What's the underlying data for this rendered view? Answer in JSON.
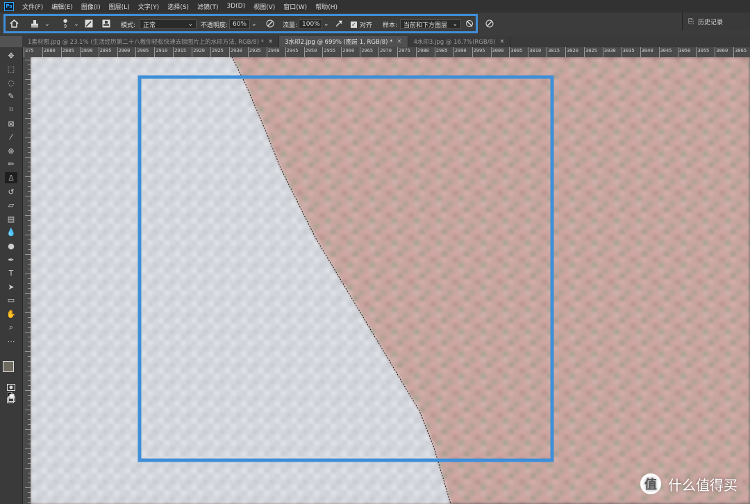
{
  "app": {
    "logo": "Ps"
  },
  "menu": [
    "文件(F)",
    "编辑(E)",
    "图像(I)",
    "图层(L)",
    "文字(Y)",
    "选择(S)",
    "滤镜(T)",
    "3D(D)",
    "视图(V)",
    "窗口(W)",
    "帮助(H)"
  ],
  "options_bar": {
    "brush_size": "9",
    "mode_label": "模式:",
    "mode_value": "正常",
    "opacity_label": "不透明度:",
    "opacity_value": "60%",
    "flow_label": "流量:",
    "flow_value": "100%",
    "align_label": "对齐",
    "align_checked": true,
    "sample_label": "样本:",
    "sample_value": "当前和下方图层"
  },
  "history_panel": {
    "label": "历史记录"
  },
  "tabs": [
    {
      "label": "1素材图.jpg @ 23.1% (生活经历第二十八教你轻松快速去除图片上的水印方法, RGB/8) *",
      "active": false
    },
    {
      "label": "3水印2.jpg @ 699% (图层 1, RGB/8) *",
      "active": true
    },
    {
      "label": "4水印3.jpg @ 16.7%(RGB/8)",
      "active": false
    }
  ],
  "ruler_labels": [
    "375",
    "2880",
    "2885",
    "2890",
    "2895",
    "2900",
    "2905",
    "2910",
    "2915",
    "2920",
    "2925",
    "2930",
    "2935",
    "2940",
    "2945",
    "2950",
    "2955",
    "2960",
    "2965",
    "2970",
    "2975",
    "2980",
    "2985",
    "2990",
    "2995",
    "3000",
    "3005",
    "3010",
    "3015",
    "3020",
    "3025",
    "3030",
    "3035",
    "3040",
    "3045",
    "3050",
    "3055",
    "3060",
    "3065",
    "30"
  ],
  "tools": [
    "move-icon",
    "marquee-icon",
    "lasso-icon",
    "quick-select-icon",
    "crop-icon",
    "frame-icon",
    "eyedropper-icon",
    "healing-icon",
    "brush-icon",
    "clone-stamp-icon",
    "history-brush-icon",
    "eraser-icon",
    "gradient-icon",
    "blur-icon",
    "dodge-icon",
    "pen-icon",
    "type-icon",
    "path-select-icon",
    "rectangle-icon",
    "hand-icon",
    "zoom-icon",
    "more-icon"
  ],
  "colors": {
    "highlight": "#3f8fd8",
    "foreground": "#6e6a5f",
    "background": "#b03a2e"
  },
  "watermark": {
    "icon": "值",
    "text": "什么值得买"
  }
}
